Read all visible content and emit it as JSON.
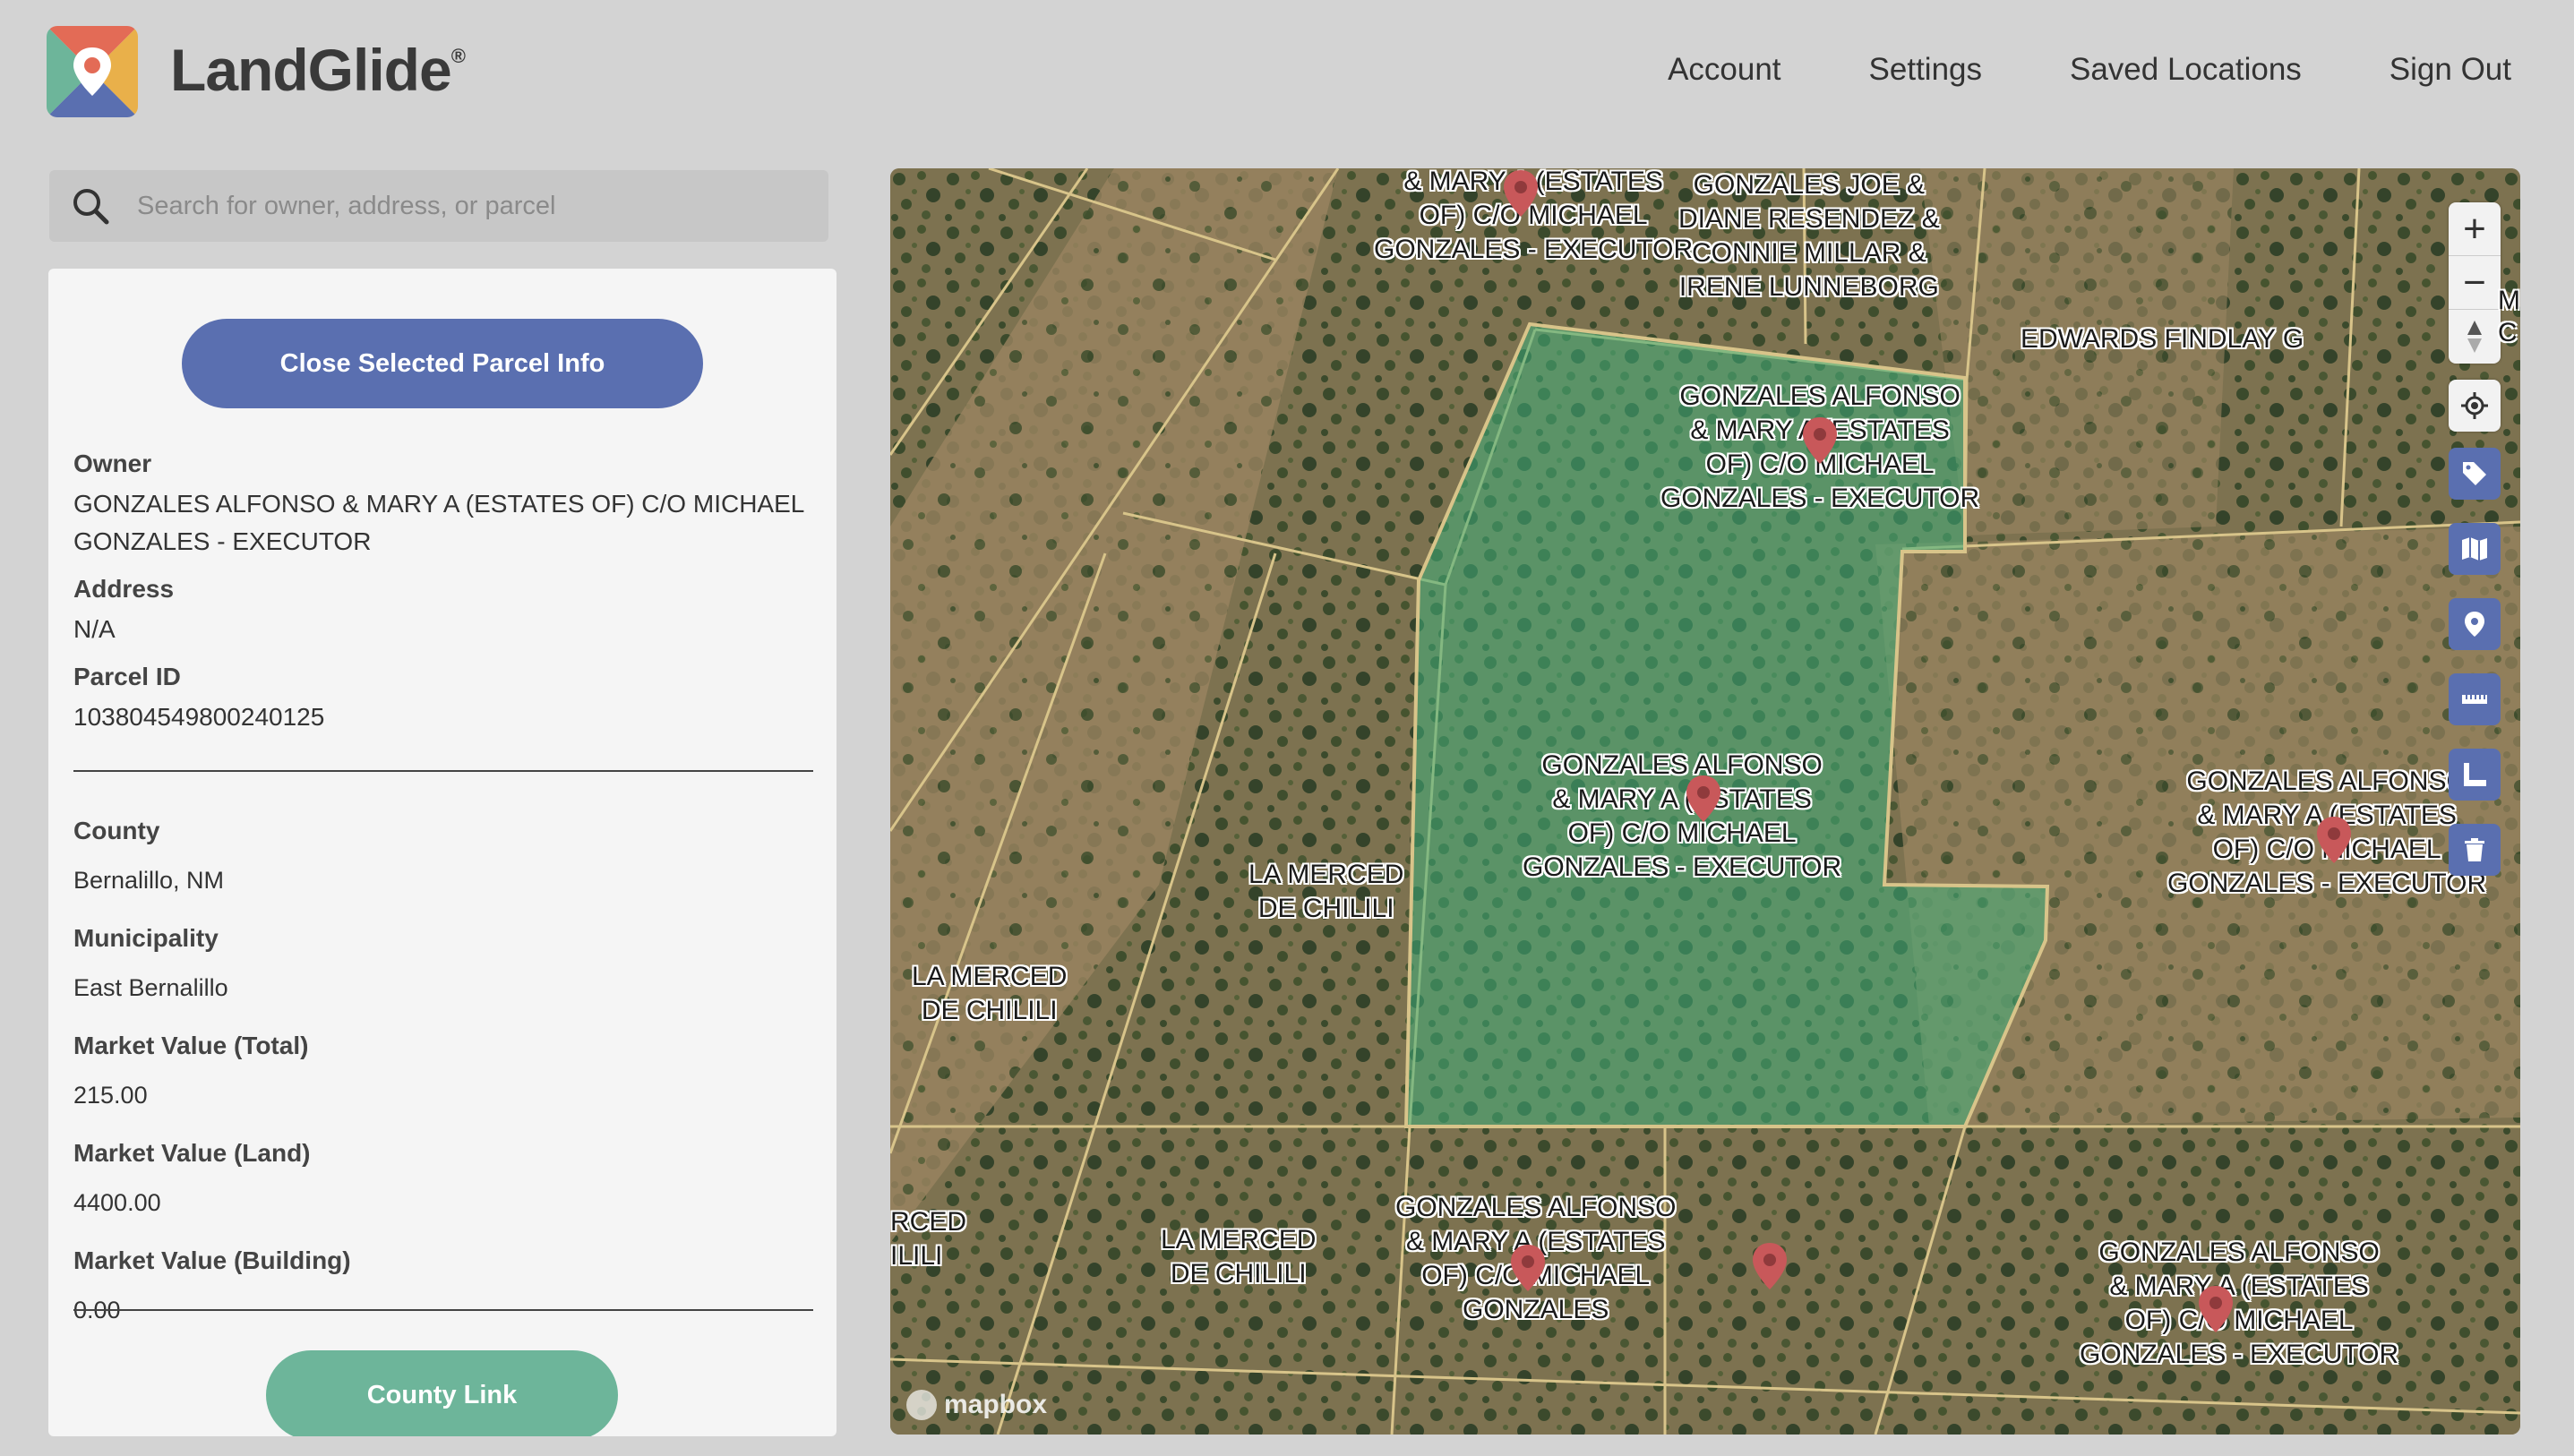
{
  "app": {
    "brand": "LandGlide",
    "trademark": "®"
  },
  "nav": {
    "items": [
      "Account",
      "Settings",
      "Saved Locations",
      "Sign Out"
    ]
  },
  "search": {
    "placeholder": "Search for owner, address, or parcel"
  },
  "panel": {
    "close_label": "Close Selected Parcel Info",
    "owner_label": "Owner",
    "owner_value": "GONZALES ALFONSO & MARY A (ESTATES OF) C/O MICHAEL GONZALES - EXECUTOR",
    "address_label": "Address",
    "address_value": "N/A",
    "parcel_label": "Parcel ID",
    "parcel_value": "103804549800240125",
    "county_label": "County",
    "county_value": "Bernalillo, NM",
    "municipality_label": "Municipality",
    "municipality_value": "East Bernalillo",
    "mv_total_label": "Market Value (Total)",
    "mv_total_value": "215.00",
    "mv_land_label": "Market Value (Land)",
    "mv_land_value": "4400.00",
    "mv_building_label": "Market Value (Building)",
    "mv_building_value": "0.00",
    "county_link_label": "County Link"
  },
  "map": {
    "labels": [
      "& MARY A (ESTATES\nOF) C/O MICHAEL\nGONZALES - EXECUTOR",
      "GONZALES JOE &\nDIANE RESENDEZ &\nCONNIE MILLAR &\nIRENE LUNNEBORG",
      "EDWARDS FINDLAY G",
      "GONZALES ALFONSO\n& MARY A (ESTATES\nOF) C/O MICHAEL\nGONZALES - EXECUTOR",
      "GONZALES ALFONSO\n& MARY A (ESTATES\nOF) C/O MICHAEL\nGONZALES - EXECUTOR",
      "GONZALES ALFONSO\n& MARY A (ESTATES\nOF) C/O MICHAEL\nGONZALES - EXECUTOR",
      "LA MERCED\nDE CHILILI",
      "LA MERCED\nDE CHILILI",
      "RCED\nILILI",
      "LA MERCED\nDE CHILILI",
      "GONZALES ALFONSO\n& MARY A (ESTATES\nOF) C/O MICHAEL\nGONZALES",
      "GONZALES ALFONSO\n& MARY A (ESTATES\nOF) C/O MICHAEL\nGONZALES - EXECUTOR"
    ],
    "attribution": "mapbox",
    "zoom_in": "+",
    "zoom_out": "−",
    "edge_label": "M\nC"
  },
  "colors": {
    "accent_blue": "#5a6fb0",
    "accent_green": "#6db59a",
    "parcel_fill": "#3fae7a"
  }
}
